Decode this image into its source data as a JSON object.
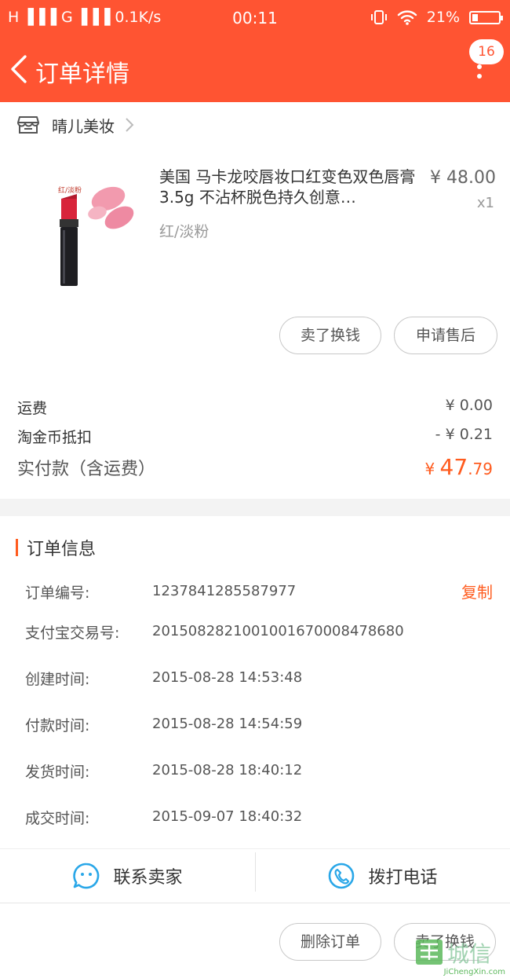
{
  "status_bar": {
    "signal_left": "H ▐▐▐  G ▐▐▐  0.1K/s",
    "time": "00:11",
    "battery": "21%"
  },
  "header": {
    "title": "订单详情",
    "badge_count": "16"
  },
  "shop": {
    "name": "晴儿美妆"
  },
  "product": {
    "title": "美国 马卡龙咬唇妆口红变色双色唇膏3.5g 不沾杯脱色持久创意…",
    "spec": "红/淡粉",
    "price": "¥ 48.00",
    "qty": "x1",
    "image_tag": "红/淡粉"
  },
  "product_actions": {
    "sell_label": "卖了换钱",
    "aftersale_label": "申请售后"
  },
  "fees": {
    "shipping_label": "运费",
    "shipping_value": "¥ 0.00",
    "coin_label": "淘金币抵扣",
    "coin_value": "- ¥ 0.21",
    "total_label": "实付款（含运费）",
    "total_currency": "¥ ",
    "total_int": "47",
    "total_dec": ".79"
  },
  "order_info": {
    "title": "订单信息",
    "copy_label": "复制",
    "rows": [
      {
        "label": "订单编号:",
        "value": "1237841285587977"
      },
      {
        "label": "支付宝交易号:",
        "value": "2015082821001001670008478680"
      },
      {
        "label": "创建时间:",
        "value": "2015-08-28 14:53:48"
      },
      {
        "label": "付款时间:",
        "value": "2015-08-28 14:54:59"
      },
      {
        "label": "发货时间:",
        "value": "2015-08-28 18:40:12"
      },
      {
        "label": "成交时间:",
        "value": "2015-09-07 18:40:32"
      }
    ]
  },
  "contact": {
    "seller_label": "联系卖家",
    "phone_label": "拨打电话"
  },
  "bottom_actions": {
    "delete_label": "删除订单",
    "sell_label": "卖了换钱"
  },
  "watermark": {
    "text": "JiChengXin.com",
    "glyphs": "城信"
  },
  "colors": {
    "brand": "#ff5432",
    "accent": "#ff5b1e",
    "icon_blue": "#2aa7e8"
  }
}
